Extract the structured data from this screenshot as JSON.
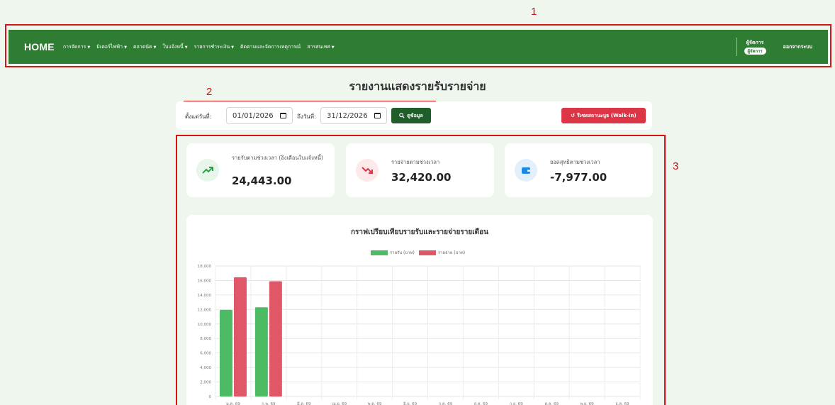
{
  "annotations": {
    "n1": "1",
    "n2": "2",
    "n3": "3"
  },
  "nav": {
    "brand": "HOME",
    "menu": [
      "การจัดการ",
      "มิเตอร์ไฟฟ้า",
      "ตลาดนัด",
      "ใบแจ้งหนี้",
      "รายการชำระเงิน",
      "ติดตามและจัดการเหตุการณ์",
      "สารสนเทศ"
    ],
    "user_name": "ผู้จัดการ",
    "user_role": "ผู้จัดการ",
    "logout": "ออกจากระบบ",
    "bg_color": "#2e7d32"
  },
  "page_title": "รายงานแสดงรายรับรายจ่าย",
  "filter": {
    "from_label": "ตั้งแต่วันที่:",
    "from_value": "01/01/2026",
    "to_label": "ถึงวันที่:",
    "to_value": "31/12/2026",
    "search_label": "ดูข้อมูล",
    "reset_label": "รีเซตสถานะบูธ (Walk-in)"
  },
  "stats": [
    {
      "label": "รายรับตามช่วงเวลา (อิงเดือนใบแจ้งหนี้)",
      "value": "24,443.00",
      "icon": "trending-up-icon",
      "color": "#2e9e4a",
      "bg": "#e7f5ea"
    },
    {
      "label": "รายจ่ายตามช่วงเวลา",
      "value": "32,420.00",
      "icon": "trending-down-icon",
      "color": "#d9364a",
      "bg": "#fde8ea"
    },
    {
      "label": "ยอดสุทธิตามช่วงเวลา",
      "value": "-7,977.00",
      "icon": "wallet-icon",
      "color": "#1e88e5",
      "bg": "#e3f0fc"
    }
  ],
  "chart_data": {
    "type": "bar",
    "title": "กราฟเปรียบเทียบรายรับและรายจ่ายรายเดือน",
    "categories": [
      "ม.ค. 69",
      "ก.พ. 69",
      "มี.ค. 69",
      "เม.ย. 69",
      "พ.ค. 69",
      "มิ.ย. 69",
      "ก.ค. 69",
      "ส.ค. 69",
      "ก.ย. 69",
      "ต.ค. 69",
      "พ.ย. 69",
      "ธ.ค. 69"
    ],
    "series": [
      {
        "name": "รายรับ (บาท)",
        "color": "#4cbb63",
        "values": [
          11950,
          12300,
          0,
          0,
          0,
          0,
          0,
          0,
          0,
          0,
          0,
          0
        ]
      },
      {
        "name": "รายจ่าย (บาท)",
        "color": "#e05867",
        "values": [
          16450,
          15900,
          0,
          0,
          0,
          0,
          0,
          0,
          0,
          0,
          0,
          0
        ]
      }
    ],
    "ylim": [
      0,
      18000
    ],
    "yticks": [
      0,
      2000,
      4000,
      6000,
      8000,
      10000,
      12000,
      14000,
      16000,
      18000
    ],
    "grid": true,
    "legend": "top-center"
  }
}
